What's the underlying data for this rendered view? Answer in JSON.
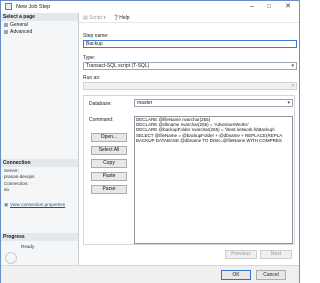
{
  "window": {
    "title": "New Job Step"
  },
  "left": {
    "select_page": "Select a page",
    "pages": [
      "General",
      "Advanced"
    ],
    "connection_header": "Connection",
    "server_label": "Server:",
    "server_value": "pranas-devops",
    "connection_label": "Connection:",
    "connection_value": "sa",
    "view_props": "View connection properties",
    "progress_header": "Progress",
    "status": "Ready"
  },
  "toolbar": {
    "script": "Script",
    "help": "Help"
  },
  "form": {
    "step_name_label": "Step name:",
    "step_name_value": "Backup",
    "type_label": "Type:",
    "type_value": "Transact-SQL script (T-SQL)",
    "run_as_label": "Run as:",
    "run_as_value": "",
    "database_label": "Database:",
    "database_value": "master",
    "command_label": "Command:"
  },
  "command_buttons": {
    "open": "Open...",
    "select_all": "Select All",
    "copy": "Copy",
    "paste": "Paste",
    "parse": "Parse"
  },
  "command_lines": [
    "DECLARE @fileName nvarchar(255)",
    "DECLARE @dbname nvarchar(255) = 'AdventureWorks'",
    "DECLARE @backupFolder nvarchar(255) = '\\\\test.network.fs\\Backup\\",
    "SELECT @fileName = @backupFolder + @dbname + REPLACE(REPLA",
    "BACKUP DATABASE @dbname TO DISK=@fileName WITH COMPRES"
  ],
  "nav": {
    "previous": "Previous",
    "next": "Next"
  },
  "footer": {
    "ok": "OK",
    "cancel": "Cancel"
  }
}
